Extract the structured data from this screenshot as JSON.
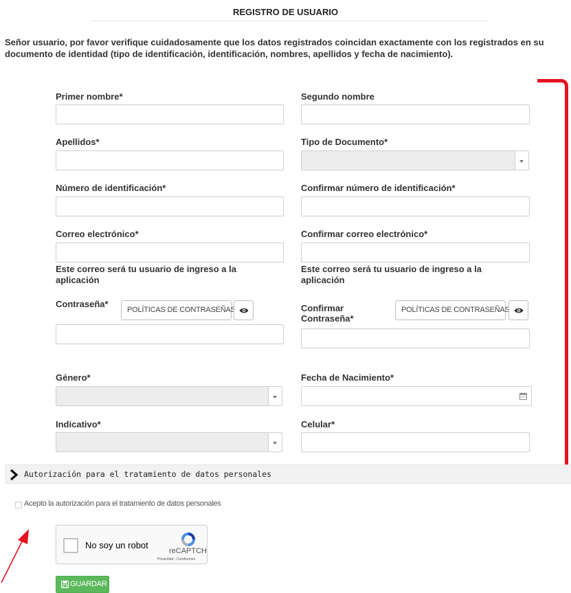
{
  "page": {
    "title": "REGISTRO DE USUARIO",
    "intro": "Señor usuario, por favor verifique cuidadosamente que los datos registrados coincidan exactamente con los registrados en su documento de identidad (tipo de identificación, identificación, nombres, apellidos y fecha de nacimiento)."
  },
  "form": {
    "primer_nombre": {
      "label": "Primer nombre*",
      "value": ""
    },
    "segundo_nombre": {
      "label": "Segundo nombre",
      "value": ""
    },
    "apellidos": {
      "label": "Apellidos*",
      "value": ""
    },
    "tipo_documento": {
      "label": "Tipo de Documento*",
      "value": ""
    },
    "numero_identificacion": {
      "label": "Número de identificación*",
      "value": ""
    },
    "confirmar_numero": {
      "label": "Confirmar número de identificación*",
      "value": ""
    },
    "correo": {
      "label": "Correo electrónico*",
      "value": "",
      "help": "Este correo será tu usuario de ingreso a la aplicación"
    },
    "confirmar_correo": {
      "label": "Confirmar correo electrónico*",
      "value": "",
      "help": "Este correo será tu usuario de ingreso a la aplicación"
    },
    "contrasena": {
      "label": "Contraseña*",
      "value": "",
      "policy_button": "POLÍTICAS DE CONTRASEÑAS"
    },
    "confirmar_contrasena": {
      "label_line1": "Confirmar",
      "label_line2": "Contraseña*",
      "value": "",
      "policy_button": "POLÍTICAS DE CONTRASEÑAS"
    },
    "genero": {
      "label": "Género*",
      "value": ""
    },
    "fecha_nacimiento": {
      "label": "Fecha de Nacimiento*",
      "value": ""
    },
    "indicativo": {
      "label": "Indicativo*",
      "value": ""
    },
    "celular": {
      "label": "Celular*",
      "value": ""
    }
  },
  "accordion": {
    "label": "Autorización para el tratamiento de datos personales",
    "expanded": false
  },
  "consent": {
    "label": "Acepto la autorización para el tratamiento de datos personales",
    "checked": false
  },
  "recaptcha": {
    "label": "No soy un robot",
    "brand": "reCAPTCHA",
    "terms": "Privacidad - Condiciones",
    "checked": false
  },
  "actions": {
    "save_label": "GUARDAR"
  },
  "icons": {
    "eye": "eye-icon",
    "calendar": "calendar-icon",
    "save": "floppy-disk-icon",
    "accordion": "chevron-right-icon",
    "dropdown": "caret-down-icon"
  },
  "colors": {
    "annotation_red": "#e31321",
    "save_green": "#5cb85c",
    "recaptcha_blue": "#1c3aa9"
  }
}
